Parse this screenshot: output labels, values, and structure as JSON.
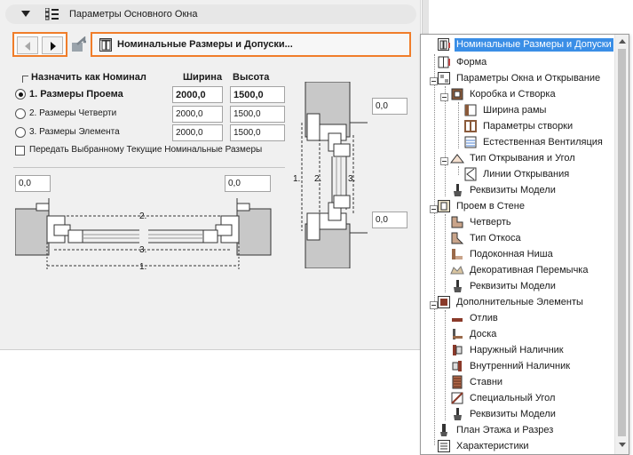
{
  "header": {
    "title": "Параметры Основного Окна"
  },
  "page_selector": {
    "current": "Номинальные Размеры и Допуски..."
  },
  "grid": {
    "assign_header": "Назначить как Номинал",
    "width_header": "Ширина",
    "height_header": "Высота",
    "rows": [
      {
        "label": "1. Размеры Проема",
        "width": "2000,0",
        "height": "1500,0",
        "selected": true
      },
      {
        "label": "2. Размеры Четверти",
        "width": "2000,0",
        "height": "1500,0",
        "selected": false
      },
      {
        "label": "3. Размеры Элемента",
        "width": "2000,0",
        "height": "1500,0",
        "selected": false
      }
    ],
    "transfer_label": "Передать Выбранному Текущие Номинальные Размеры"
  },
  "drawing": {
    "tol_left": "0,0",
    "tol_right": "0,0",
    "tol_top": "0,0",
    "tol_bottom": "0,0",
    "horizontal_marks": [
      "2.",
      "3.",
      "1."
    ],
    "vertical_marks": [
      "1.",
      "2.",
      "3."
    ]
  },
  "tree": {
    "items": [
      {
        "label": "Номинальные Размеры и Допуски",
        "selected": true
      },
      {
        "label": "Форма"
      },
      {
        "label": "Параметры Окна и Открывание"
      },
      {
        "label": "Коробка и Створка"
      },
      {
        "label": "Ширина рамы"
      },
      {
        "label": "Параметры створки"
      },
      {
        "label": "Естественная Вентиляция"
      },
      {
        "label": "Тип Открывания и Угол"
      },
      {
        "label": "Линии Открывания"
      },
      {
        "label": "Реквизиты Модели"
      },
      {
        "label": "Проем в Стене"
      },
      {
        "label": "Четверть"
      },
      {
        "label": "Тип Откоса"
      },
      {
        "label": "Подоконная Ниша"
      },
      {
        "label": "Декоративная Перемычка"
      },
      {
        "label": "Реквизиты Модели"
      },
      {
        "label": "Дополнительные Элементы"
      },
      {
        "label": "Отлив"
      },
      {
        "label": "Доска"
      },
      {
        "label": "Наружный Наличник"
      },
      {
        "label": "Внутренний Наличник"
      },
      {
        "label": "Ставни"
      },
      {
        "label": "Специальный Угол"
      },
      {
        "label": "Реквизиты Модели"
      },
      {
        "label": "План Этажа и Разрез"
      },
      {
        "label": "Характеристики"
      }
    ]
  },
  "colors": {
    "highlight": "#f07d2a",
    "selection": "#3a8ee6",
    "panel": "#f0f0f0"
  }
}
